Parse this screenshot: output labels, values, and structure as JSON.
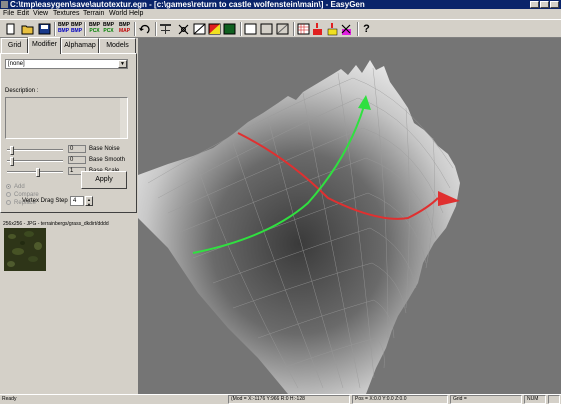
{
  "title_bar": {
    "title": "C:\\tmp\\easygen\\save\\autotextur.egn - [c:\\games\\return to castle wolfenstein\\main\\] - EasyGen"
  },
  "menu": [
    "File",
    "Edit",
    "View",
    "Textures",
    "Terrain",
    "World",
    "Help"
  ],
  "toolbar": {
    "bmp_save_label": "BMP",
    "bmp_load_label": "BMP",
    "pcx_save_label": "PCX",
    "pcx_load_label": "PCX",
    "bmp_small_1": "BMP",
    "bmp_small_2": "BMP",
    "bmp_small_3": "BMP",
    "bmp_small_4": "BMP",
    "map_small": "BMP",
    "map_label": "MAP",
    "help_label": "?"
  },
  "tabs": [
    "Grid",
    "Modifier",
    "Alphamap",
    "Models"
  ],
  "modifier": {
    "selected": "[none]",
    "description_label": "Description :",
    "noise": {
      "value": "0",
      "label": "Base Noise",
      "level": 0.05
    },
    "smooth": {
      "value": "0",
      "label": "Base Smooth",
      "level": 0.05
    },
    "scale": {
      "value": "1",
      "label": "Base Scale",
      "level": 0.55
    },
    "radio": [
      "Add",
      "Compare",
      "Replace"
    ],
    "apply_label": "Apply",
    "vertex_drag_label": "Vertex Drag Step",
    "vertex_drag_value": "4"
  },
  "texture_info": "256x256 - JPG - terrainbergs/grass_dkdirt/dddd",
  "status": {
    "ready": "Ready",
    "mod": "(Mod = X:-1176 Y:966 R:0 H:-128",
    "pos": "Pos = X:0.0 Y:0.0 Z:0.0",
    "grid": "Grid =",
    "num": "NUM"
  },
  "colors": {
    "titlebar": "#0a246a",
    "face": "#d4d0c8",
    "viewport": "#757575",
    "axis_x": "#e03030",
    "axis_y": "#30e040"
  }
}
